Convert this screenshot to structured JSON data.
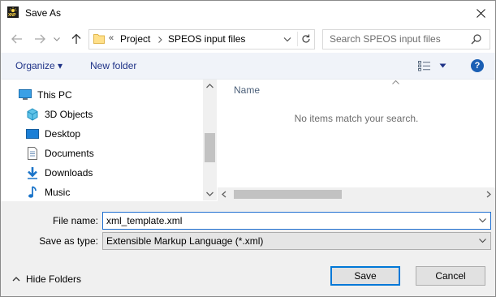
{
  "window": {
    "title": "Save As",
    "app_logo_text": "XNP"
  },
  "addressbar": {
    "overflow": "«",
    "crumbs": [
      "Project",
      "SPEOS input files"
    ]
  },
  "search": {
    "placeholder": "Search SPEOS input files"
  },
  "commandbar": {
    "organize": "Organize ▾",
    "new_folder": "New folder",
    "help": "?"
  },
  "navpane": {
    "items": [
      {
        "label": "This PC",
        "icon": "this-pc-icon"
      },
      {
        "label": "3D Objects",
        "icon": "3d-objects-icon"
      },
      {
        "label": "Desktop",
        "icon": "desktop-icon"
      },
      {
        "label": "Documents",
        "icon": "documents-icon"
      },
      {
        "label": "Downloads",
        "icon": "downloads-icon"
      },
      {
        "label": "Music",
        "icon": "music-icon"
      }
    ]
  },
  "filepane": {
    "column_name": "Name",
    "empty_message": "No items match your search."
  },
  "form": {
    "file_name_label": "File name:",
    "file_name_value": "xml_template.xml",
    "save_type_label": "Save as type:",
    "save_type_value": "Extensible Markup Language (*.xml)"
  },
  "footer": {
    "hide_folders": "Hide Folders",
    "save": "Save",
    "cancel": "Cancel"
  },
  "colors": {
    "accent": "#0078d7",
    "link": "#1e3287",
    "help": "#1a5fb4"
  }
}
